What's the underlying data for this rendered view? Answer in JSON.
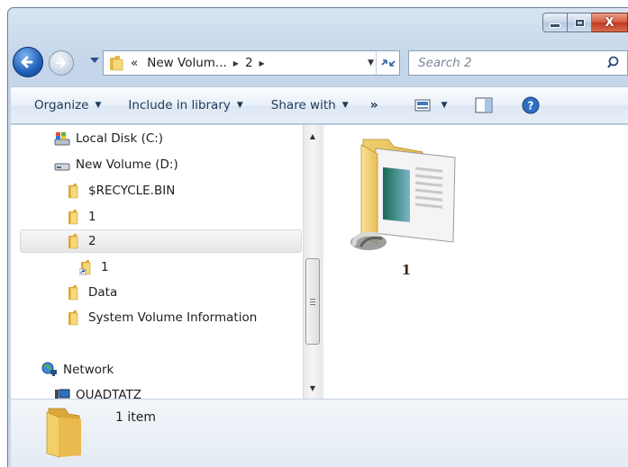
{
  "window": {
    "caption_buttons": {
      "minimize": "–",
      "maximize": "□",
      "close": "X"
    }
  },
  "address_bar": {
    "overflow_chevron": "«",
    "breadcrumbs": [
      "New Volum...",
      "2"
    ],
    "refresh_icon": "refresh-arrows-icon"
  },
  "search": {
    "placeholder": "Search 2",
    "value": ""
  },
  "toolbar": {
    "organize": "Organize",
    "include_in_library": "Include in library",
    "share_with": "Share with",
    "more": "»",
    "icons": [
      "change-view-icon",
      "preview-pane-icon",
      "help-icon"
    ]
  },
  "nav_tree": {
    "items": [
      {
        "label": "Local Disk (C:)",
        "icon": "drive-windows-icon",
        "selected": false
      },
      {
        "label": "New Volume (D:)",
        "icon": "drive-icon",
        "selected": false
      },
      {
        "label": "$RECYCLE.BIN",
        "icon": "folder-icon",
        "selected": false
      },
      {
        "label": "1",
        "icon": "folder-icon",
        "selected": false
      },
      {
        "label": "2",
        "icon": "folder-icon",
        "selected": true
      },
      {
        "label": "1",
        "icon": "shortcut-folder-icon",
        "selected": false
      },
      {
        "label": "Data",
        "icon": "folder-icon",
        "selected": false
      },
      {
        "label": "System Volume Information",
        "icon": "folder-icon",
        "selected": false
      },
      {
        "label": "Network",
        "icon": "network-icon",
        "selected": false
      },
      {
        "label": "QUADTATZ",
        "icon": "computer-icon",
        "selected": false
      }
    ]
  },
  "content": {
    "items": [
      {
        "label": "1",
        "icon": "shortcut-folder-icon"
      }
    ]
  },
  "details": {
    "count": "1 item"
  },
  "colors": {
    "window_frame": "#c9d9ec",
    "toolbar_text": "#1e395b",
    "selection": "#e6e6e6",
    "folder": "#f0cd62"
  }
}
